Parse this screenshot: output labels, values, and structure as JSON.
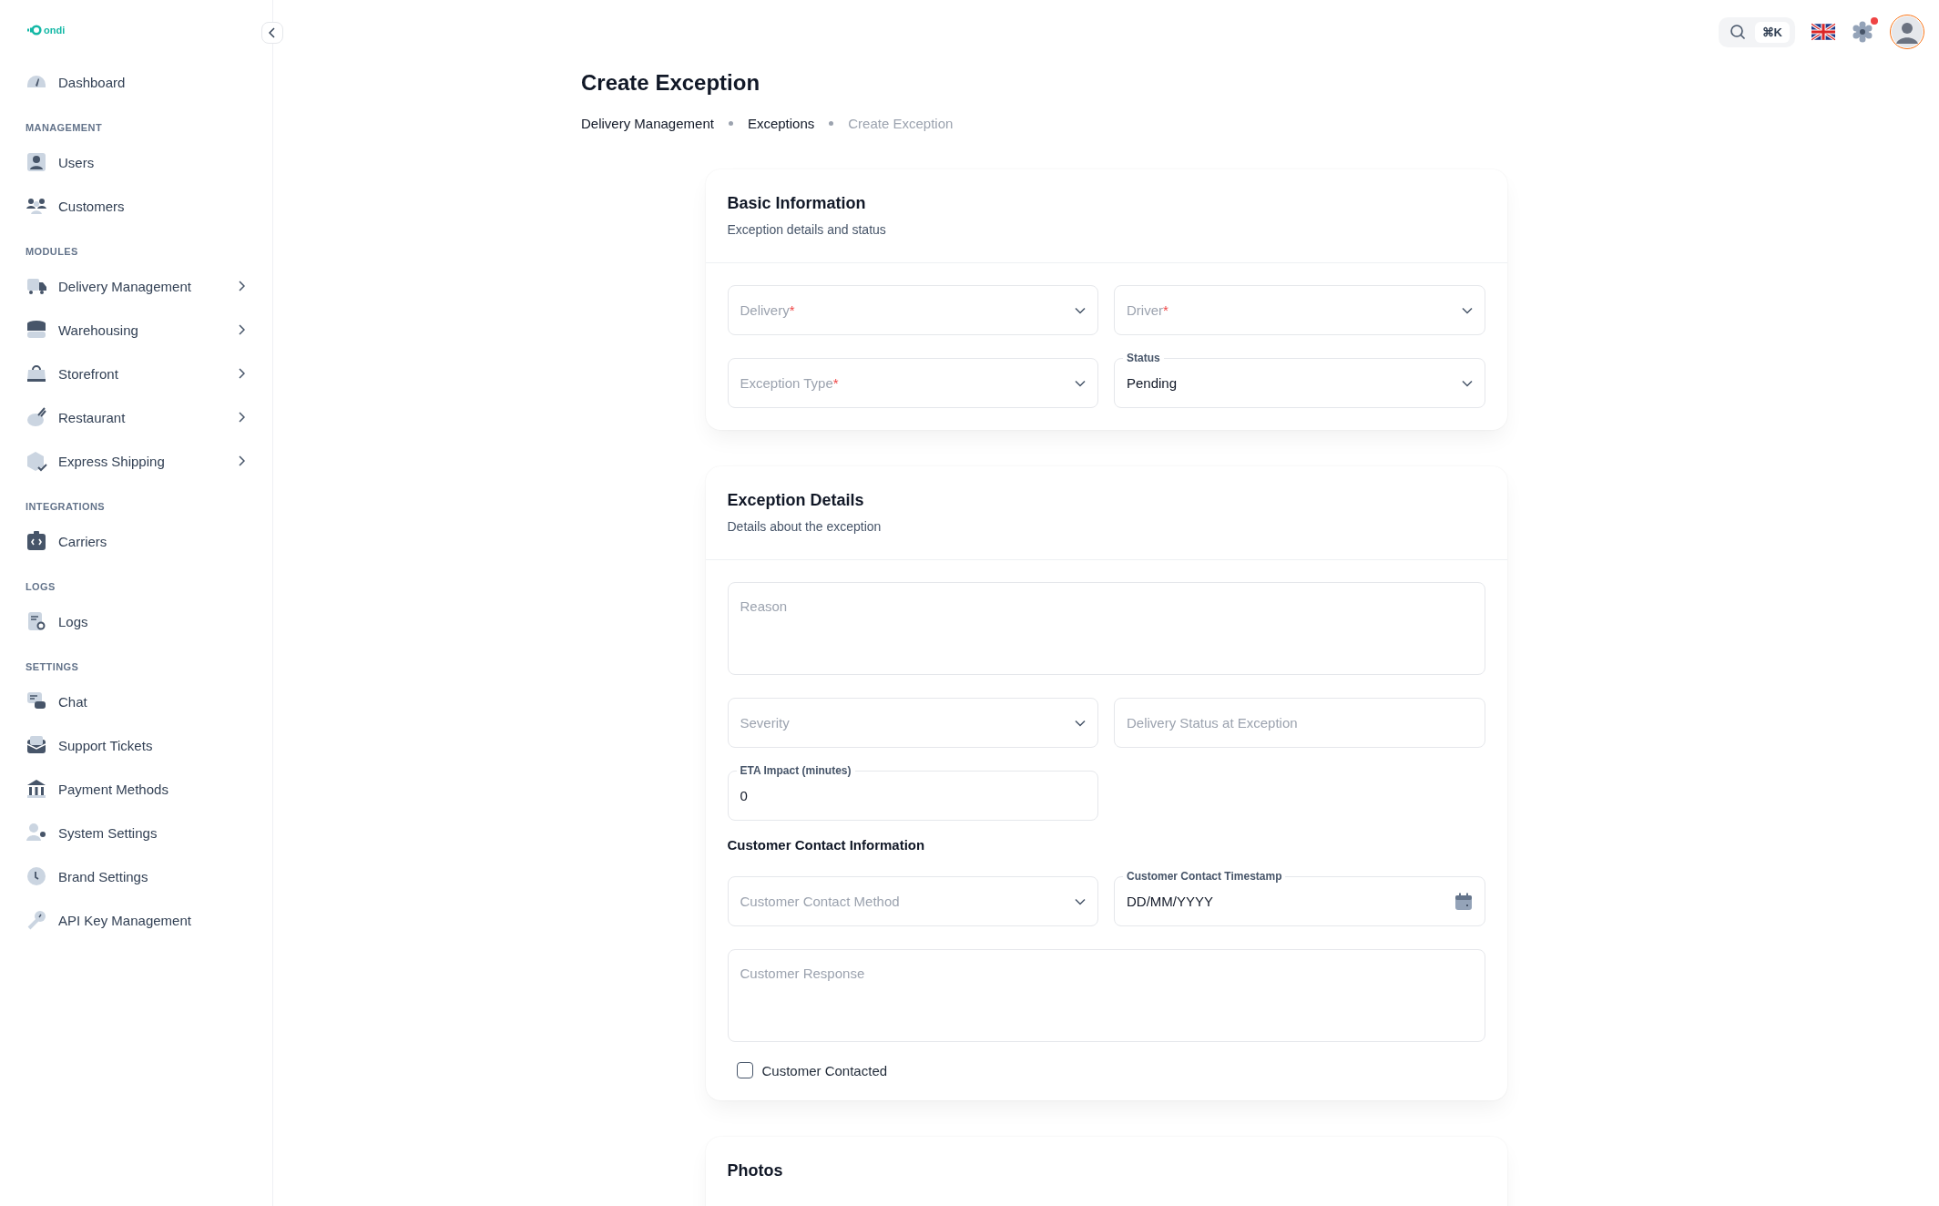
{
  "logo": {
    "text": "ondi"
  },
  "sidebar": {
    "sections": [
      {
        "items": [
          {
            "label": "Dashboard",
            "expandable": false
          }
        ]
      },
      {
        "heading": "MANAGEMENT",
        "items": [
          {
            "label": "Users",
            "expandable": false
          },
          {
            "label": "Customers",
            "expandable": false
          }
        ]
      },
      {
        "heading": "MODULES",
        "items": [
          {
            "label": "Delivery Management",
            "expandable": true
          },
          {
            "label": "Warehousing",
            "expandable": true
          },
          {
            "label": "Storefront",
            "expandable": true
          },
          {
            "label": "Restaurant",
            "expandable": true
          },
          {
            "label": "Express Shipping",
            "expandable": true
          }
        ]
      },
      {
        "heading": "INTEGRATIONS",
        "items": [
          {
            "label": "Carriers",
            "expandable": false
          }
        ]
      },
      {
        "heading": "LOGS",
        "items": [
          {
            "label": "Logs",
            "expandable": false
          }
        ]
      },
      {
        "heading": "SETTINGS",
        "items": [
          {
            "label": "Chat",
            "expandable": false
          },
          {
            "label": "Support Tickets",
            "expandable": false
          },
          {
            "label": "Payment Methods",
            "expandable": false
          },
          {
            "label": "System Settings",
            "expandable": false
          },
          {
            "label": "Brand Settings",
            "expandable": false
          },
          {
            "label": "API Key Management",
            "expandable": false
          }
        ]
      }
    ]
  },
  "topbar": {
    "shortcut": "⌘K",
    "settings_notification": true
  },
  "page": {
    "title": "Create Exception",
    "breadcrumbs": [
      {
        "label": "Delivery Management",
        "current": false
      },
      {
        "label": "Exceptions",
        "current": false
      },
      {
        "label": "Create Exception",
        "current": true
      }
    ]
  },
  "cards": [
    {
      "title": "Basic Information",
      "subtitle": "Exception details and status",
      "blocks": [
        {
          "kind": "fields",
          "rows": [
            [
              {
                "kind": "select",
                "label": "Delivery",
                "required_mark": "*"
              },
              {
                "kind": "select",
                "label": "Driver",
                "required_mark": "*"
              }
            ],
            [
              {
                "kind": "select",
                "label": "Exception Type",
                "required_mark": "*"
              },
              {
                "kind": "select",
                "label": "Status",
                "value": "Pending"
              }
            ]
          ]
        }
      ]
    },
    {
      "title": "Exception Details",
      "subtitle": "Details about the exception",
      "blocks": [
        {
          "kind": "fields",
          "rows": [
            [
              {
                "kind": "textarea",
                "label": "Reason"
              }
            ],
            [
              {
                "kind": "select",
                "label": "Severity"
              },
              {
                "kind": "text",
                "label": "Delivery Status at Exception"
              }
            ],
            [
              {
                "kind": "text",
                "label": "ETA Impact (minutes)",
                "value": "0"
              }
            ]
          ]
        },
        {
          "kind": "subheading",
          "text": "Customer Contact Information"
        },
        {
          "kind": "fields",
          "rows": [
            [
              {
                "kind": "select",
                "label": "Customer Contact Method"
              },
              {
                "kind": "date",
                "label": "Customer Contact Timestamp",
                "value": "DD/MM/YYYY"
              }
            ],
            [
              {
                "kind": "textarea",
                "label": "Customer Response"
              }
            ]
          ]
        },
        {
          "kind": "checkbox",
          "label": "Customer Contacted",
          "checked": false
        }
      ]
    },
    {
      "title": "Photos"
    }
  ]
}
